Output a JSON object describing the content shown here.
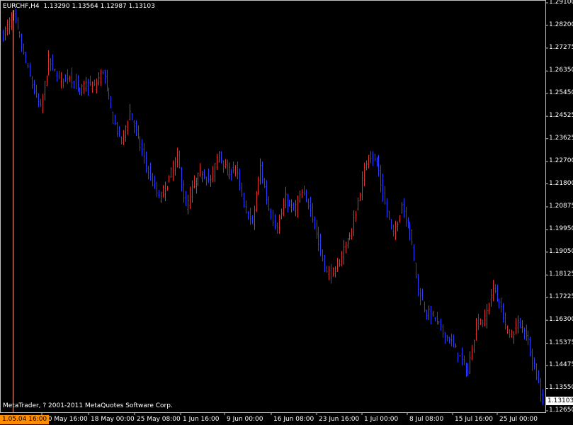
{
  "header": {
    "symbol_label": "EURCHF,H4",
    "quote": "1.13290 1.13564 1.12987 1.13103"
  },
  "footer": {
    "copyright": "MetaTrader, ? 2001-2011 MetaQuotes Software Corp."
  },
  "price_axis": {
    "ticks": [
      "1.29100",
      "1.28200",
      "1.27275",
      "1.26350",
      "1.25450",
      "1.24525",
      "1.23625",
      "1.22700",
      "1.21800",
      "1.20875",
      "1.19950",
      "1.19050",
      "1.18125",
      "1.17225",
      "1.16300",
      "1.15375",
      "1.14475",
      "1.13550",
      "1.12650"
    ],
    "current_price": "1.13103"
  },
  "time_axis": {
    "ticks": [
      "10 May 16:00",
      "18 May 00:00",
      "25 May 08:00",
      "1 Jun 16:00",
      "9 Jun 00:00",
      "16 Jun 08:00",
      "23 Jun 16:00",
      "1 Jul 00:00",
      "8 Jul 08:00",
      "15 Jul 16:00",
      "25 Jul 00:00"
    ],
    "cursor_label": "1.05.04 16:00"
  },
  "colors": {
    "background": "#000000",
    "axis": "#c0c0c0",
    "up_bar": "#e03030",
    "down_bar": "#2a3cff",
    "crosshair": "#ff9e7a",
    "cursor_label_bg": "#ff8c00"
  },
  "chart_data": {
    "type": "ohlc",
    "instrument": "EURCHF",
    "timeframe": "H4",
    "ylim": [
      1.1265,
      1.291
    ],
    "anchors": [
      [
        0,
        1.278
      ],
      [
        5,
        1.286
      ],
      [
        10,
        1.27
      ],
      [
        14,
        1.258
      ],
      [
        18,
        1.248
      ],
      [
        22,
        1.268
      ],
      [
        27,
        1.26
      ],
      [
        32,
        1.262
      ],
      [
        37,
        1.255
      ],
      [
        40,
        1.258
      ],
      [
        44,
        1.257
      ],
      [
        48,
        1.264
      ],
      [
        53,
        1.244
      ],
      [
        57,
        1.235
      ],
      [
        61,
        1.247
      ],
      [
        65,
        1.236
      ],
      [
        70,
        1.223
      ],
      [
        75,
        1.212
      ],
      [
        79,
        1.218
      ],
      [
        84,
        1.229
      ],
      [
        88,
        1.208
      ],
      [
        92,
        1.218
      ],
      [
        96,
        1.223
      ],
      [
        100,
        1.219
      ],
      [
        104,
        1.231
      ],
      [
        108,
        1.222
      ],
      [
        112,
        1.225
      ],
      [
        116,
        1.209
      ],
      [
        120,
        1.202
      ],
      [
        124,
        1.225
      ],
      [
        128,
        1.208
      ],
      [
        132,
        1.2
      ],
      [
        136,
        1.212
      ],
      [
        140,
        1.207
      ],
      [
        144,
        1.214
      ],
      [
        148,
        1.209
      ],
      [
        152,
        1.194
      ],
      [
        156,
        1.182
      ],
      [
        160,
        1.182
      ],
      [
        164,
        1.192
      ],
      [
        168,
        1.199
      ],
      [
        173,
        1.219
      ],
      [
        176,
        1.231
      ],
      [
        180,
        1.226
      ],
      [
        184,
        1.21
      ],
      [
        188,
        1.197
      ],
      [
        192,
        1.21
      ],
      [
        196,
        1.199
      ],
      [
        200,
        1.175
      ],
      [
        204,
        1.166
      ],
      [
        208,
        1.164
      ],
      [
        212,
        1.158
      ],
      [
        216,
        1.154
      ],
      [
        220,
        1.148
      ],
      [
        224,
        1.142
      ],
      [
        228,
        1.162
      ],
      [
        232,
        1.163
      ],
      [
        236,
        1.177
      ],
      [
        240,
        1.167
      ],
      [
        244,
        1.156
      ],
      [
        248,
        1.162
      ],
      [
        252,
        1.158
      ],
      [
        256,
        1.144
      ],
      [
        260,
        1.131
      ]
    ]
  }
}
